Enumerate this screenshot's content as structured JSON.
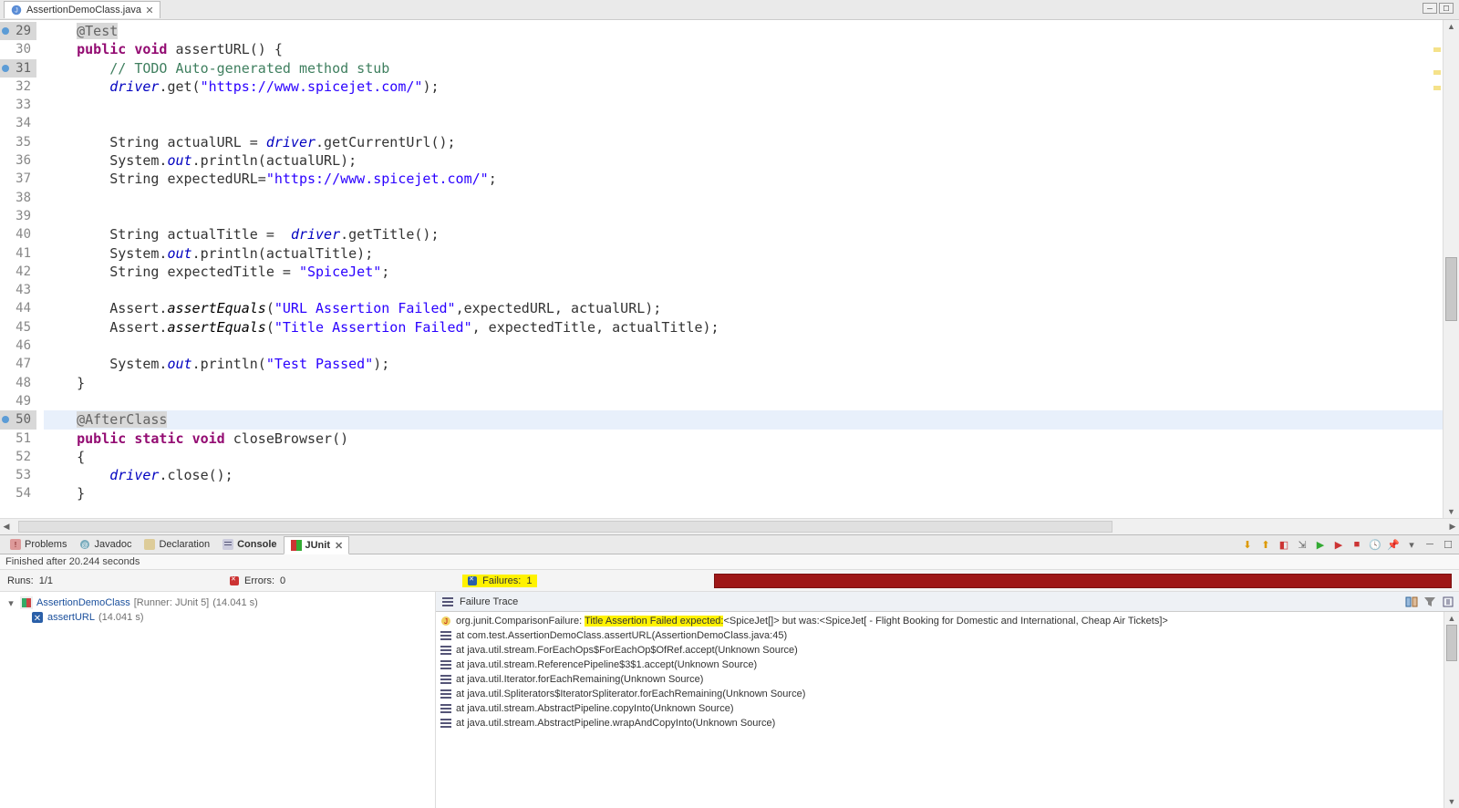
{
  "editor": {
    "tab_label": "AssertionDemoClass.java",
    "lines": [
      {
        "n": "29",
        "ann": true,
        "cls": "",
        "html": "    <span class='ann'>@Test</span>"
      },
      {
        "n": "30",
        "html": "    <span class='kw'>public</span> <span class='kw'>void</span> assertURL() {"
      },
      {
        "n": "31",
        "ann": true,
        "html": "        <span class='cm'>// TODO Auto-generated method stub</span>"
      },
      {
        "n": "32",
        "html": "        <span class='fld'>driver</span>.get(<span class='str'>\"https://www.spicejet.com/\"</span>);"
      },
      {
        "n": "33",
        "html": ""
      },
      {
        "n": "34",
        "html": ""
      },
      {
        "n": "35",
        "html": "        String actualURL = <span class='fld'>driver</span>.getCurrentUrl();"
      },
      {
        "n": "36",
        "html": "        System.<span class='sfld'>out</span>.println(actualURL);"
      },
      {
        "n": "37",
        "html": "        String expectedURL=<span class='str'>\"https://www.spicejet.com/\"</span>;"
      },
      {
        "n": "38",
        "html": ""
      },
      {
        "n": "39",
        "html": ""
      },
      {
        "n": "40",
        "html": "        String actualTitle =  <span class='fld'>driver</span>.getTitle();"
      },
      {
        "n": "41",
        "html": "        System.<span class='sfld'>out</span>.println(actualTitle);"
      },
      {
        "n": "42",
        "html": "        String expectedTitle = <span class='str'>\"SpiceJet\"</span>;"
      },
      {
        "n": "43",
        "html": ""
      },
      {
        "n": "44",
        "html": "        Assert.<span class='mth'>assertEquals</span>(<span class='str'>\"URL Assertion Failed\"</span>,expectedURL, actualURL);"
      },
      {
        "n": "45",
        "html": "        Assert.<span class='mth'>assertEquals</span>(<span class='str'>\"Title Assertion Failed\"</span>, expectedTitle, actualTitle);"
      },
      {
        "n": "46",
        "html": ""
      },
      {
        "n": "47",
        "html": "        System.<span class='sfld'>out</span>.println(<span class='str'>\"Test Passed\"</span>);"
      },
      {
        "n": "48",
        "html": "    }"
      },
      {
        "n": "49",
        "html": ""
      },
      {
        "n": "50",
        "ann": true,
        "hl": true,
        "html": "    <span class='ann'>@AfterClass</span>"
      },
      {
        "n": "51",
        "html": "    <span class='kw'>public</span> <span class='kw'>static</span> <span class='kw'>void</span> closeBrowser()"
      },
      {
        "n": "52",
        "html": "    {"
      },
      {
        "n": "53",
        "html": "        <span class='fld'>driver</span>.close();"
      },
      {
        "n": "54",
        "html": "    }"
      }
    ]
  },
  "bottom_tabs": {
    "problems": "Problems",
    "javadoc": "Javadoc",
    "declaration": "Declaration",
    "console": "Console",
    "junit": "JUnit"
  },
  "junit": {
    "status": "Finished after 20.244 seconds",
    "runs_label": "Runs:",
    "runs_value": "1/1",
    "errors_label": "Errors:",
    "errors_value": "0",
    "failures_label": "Failures:",
    "failures_value": "1",
    "tree": {
      "root": "AssertionDemoClass",
      "root_meta": "[Runner: JUnit 5]",
      "root_time": "(14.041 s)",
      "child": "assertURL",
      "child_time": "(14.041 s)"
    },
    "trace_header": "Failure Trace",
    "trace": [
      {
        "icon": "j",
        "pre": "org.junit.ComparisonFailure: ",
        "hl": "Title Assertion Failed expected:",
        "post": "<SpiceJet[]> but was:<SpiceJet[ - Flight Booking for Domestic and International, Cheap Air Tickets]>"
      },
      {
        "icon": "s",
        "text": "at com.test.AssertionDemoClass.assertURL(AssertionDemoClass.java:45)"
      },
      {
        "icon": "s",
        "text": "at java.util.stream.ForEachOps$ForEachOp$OfRef.accept(Unknown Source)"
      },
      {
        "icon": "s",
        "text": "at java.util.stream.ReferencePipeline$3$1.accept(Unknown Source)"
      },
      {
        "icon": "s",
        "text": "at java.util.Iterator.forEachRemaining(Unknown Source)"
      },
      {
        "icon": "s",
        "text": "at java.util.Spliterators$IteratorSpliterator.forEachRemaining(Unknown Source)"
      },
      {
        "icon": "s",
        "text": "at java.util.stream.AbstractPipeline.copyInto(Unknown Source)"
      },
      {
        "icon": "s",
        "text": "at java.util.stream.AbstractPipeline.wrapAndCopyInto(Unknown Source)"
      }
    ]
  }
}
